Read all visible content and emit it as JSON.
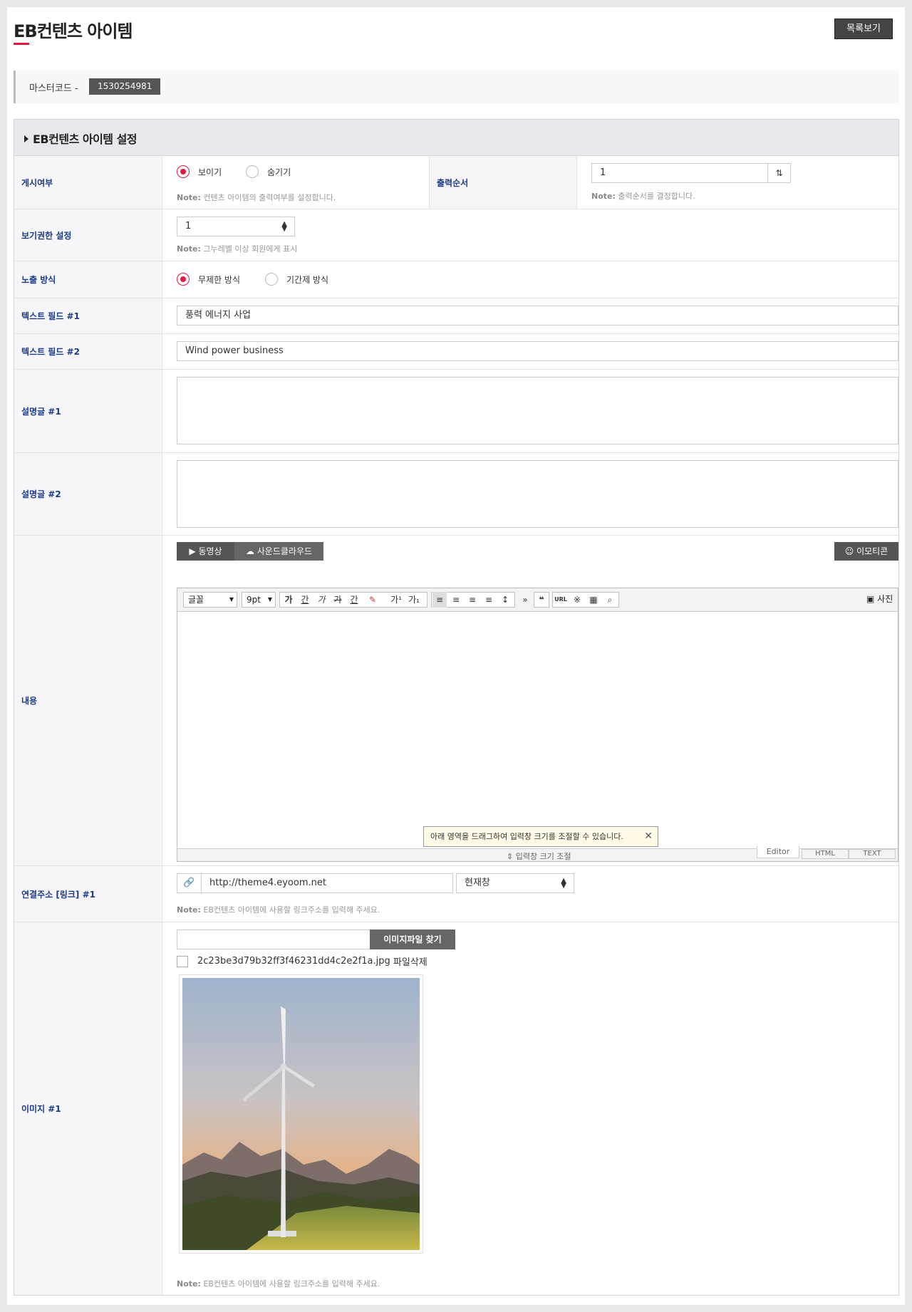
{
  "header": {
    "title": "EB컨텐츠 아이템",
    "list_button": "목록보기"
  },
  "master": {
    "label": "마스터코드 -",
    "code": "1530254981"
  },
  "section": {
    "title": "EB컨텐츠 아이템 설정"
  },
  "display": {
    "label": "게시여부",
    "options": [
      "보이기",
      "숨기기"
    ],
    "selected": "보이기",
    "note_bold": "Note:",
    "note": "컨텐츠 아이템의 출력여부를 설정합니다."
  },
  "order": {
    "label": "출력순서",
    "value": "1",
    "note_bold": "Note:",
    "note": "출력순서를 결정합니다."
  },
  "permission": {
    "label": "보기권한 설정",
    "value": "1",
    "note_bold": "Note:",
    "note": "그누레벨 이상 회원에게 표시"
  },
  "exposure": {
    "label": "노출 방식",
    "options": [
      "무제한 방식",
      "기간제 방식"
    ],
    "selected": "무제한 방식"
  },
  "text1": {
    "label": "텍스트 필드 #1",
    "value": "풍력 에너지 사업"
  },
  "text2": {
    "label": "텍스트 필드 #2",
    "value": "Wind power business"
  },
  "desc1": {
    "label": "설명글 #1"
  },
  "desc2": {
    "label": "설명글 #2"
  },
  "content": {
    "label": "내용",
    "video_tab": "동영상",
    "soundcloud_tab": "사운드클라우드",
    "emoticon_button": "이모티콘",
    "toolbar": {
      "font": "글꼴",
      "size": "9pt",
      "bold": "가",
      "underline": "간",
      "italic": "가",
      "strike": "가",
      "color": "간",
      "superscript": "가¹",
      "subscript": "가₁",
      "quote": "❝",
      "url": "URL",
      "photo": "사진"
    },
    "resize_tip": "아래 영역을 드래그하여 입력창 크기를 조절할 수 있습니다.",
    "resize_label": "입력창 크기 조절",
    "modes": [
      "Editor",
      "HTML",
      "TEXT"
    ]
  },
  "link": {
    "label": "연결주소 [링크] #1",
    "url": "http://theme4.eyoom.net",
    "target": "현재창",
    "note_bold": "Note:",
    "note": "EB컨텐츠 아이템에 사용할 링크주소를 입력해 주세요."
  },
  "image": {
    "label": "이미지 #1",
    "find_button": "이미지파일 찾기",
    "filename": "2c23be3d79b32ff3f46231dd4c2e2f1a.jpg",
    "delete_label": "파일삭제",
    "note_bold": "Note:",
    "note": "EB컨텐츠 아이템에 사용할 링크주소를 입력해 주세요."
  },
  "colors": {
    "accent": "#e5173f",
    "label": "#1b3a8a",
    "dark_button": "#444444"
  }
}
